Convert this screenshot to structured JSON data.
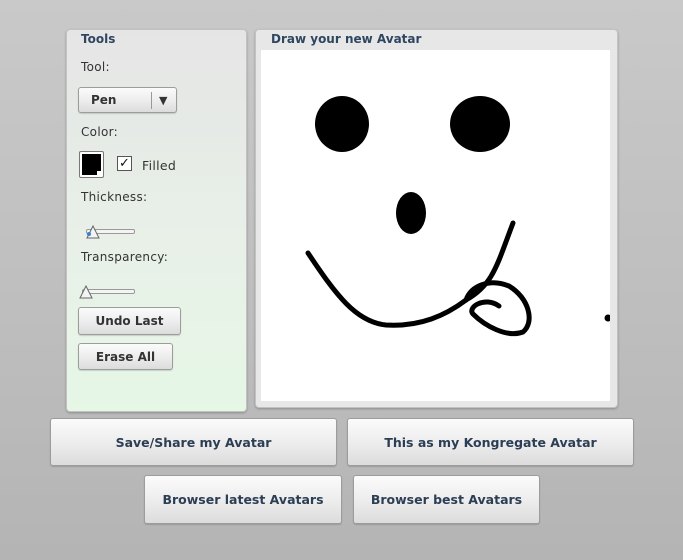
{
  "tools": {
    "title": "Tools",
    "tool_label": "Tool:",
    "tool_value": "Pen",
    "color_label": "Color:",
    "color_value": "#000000",
    "filled_label": "Filled",
    "filled_checked": true,
    "thickness_label": "Thickness:",
    "thickness_level": 0.2,
    "transparency_label": "Transparency:",
    "transparency_level": 0.0,
    "undo_label": "Undo Last",
    "erase_label": "Erase All"
  },
  "canvas": {
    "title": "Draw your new Avatar",
    "background": "#ffffff",
    "stroke_color": "#000000"
  },
  "actions": {
    "save_label": "Save/Share my Avatar",
    "kongregate_label": "This as my Kongregate Avatar",
    "latest_label": "Browser latest Avatars",
    "best_label": "Browser best Avatars"
  }
}
